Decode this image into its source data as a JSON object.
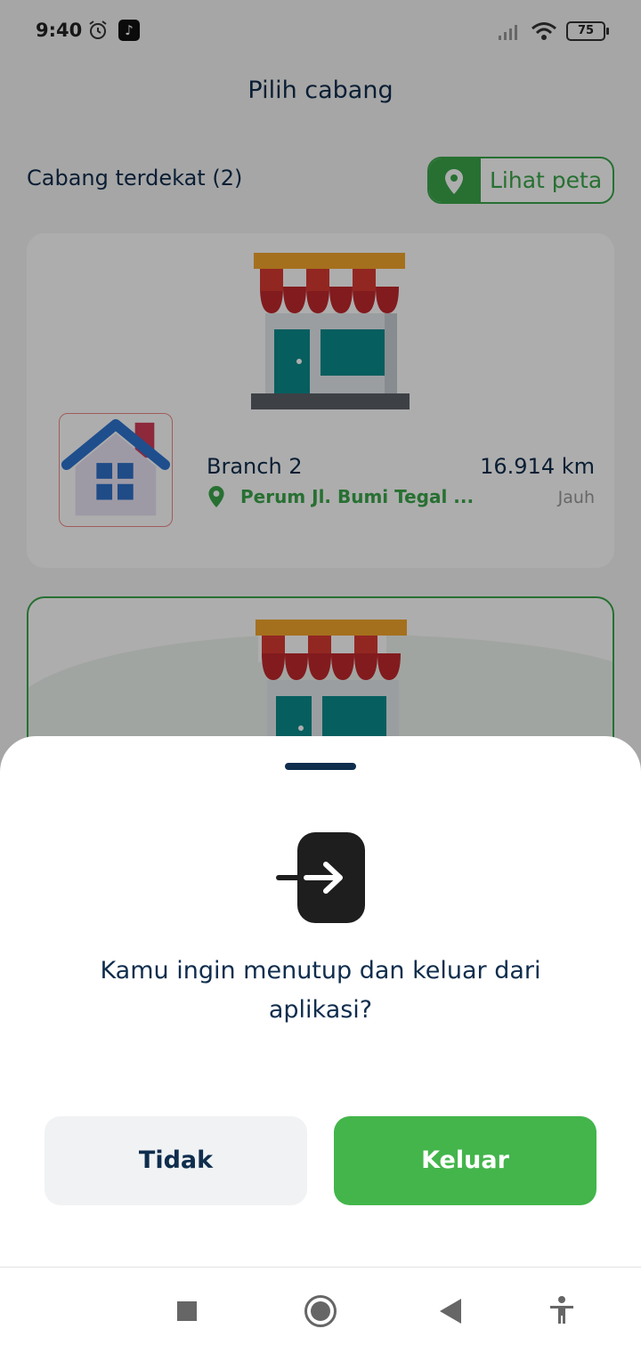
{
  "status_bar": {
    "time": "9:40",
    "battery": "75",
    "icons": [
      "alarm-icon",
      "tiktok-icon",
      "signal-icon",
      "wifi-icon",
      "battery-icon"
    ]
  },
  "header": {
    "title": "Pilih cabang"
  },
  "branches": {
    "nearby_label": "Cabang terdekat (2)",
    "map_button_label": "Lihat peta",
    "items": [
      {
        "name": "Branch 2",
        "address": "Perum Jl. Bumi Tegal ...",
        "distance": "16.914 km",
        "proximity": "Jauh"
      }
    ]
  },
  "exit_dialog": {
    "icon": "exit-icon",
    "message": "Kamu ingin menutup dan keluar dari aplikasi?",
    "cancel_label": "Tidak",
    "confirm_label": "Keluar",
    "colors": {
      "confirm": "#43b54b",
      "cancel": "#f0f2f4",
      "text": "#0f2d4d"
    }
  },
  "navigation": {
    "icons": [
      "recents-icon",
      "home-icon",
      "back-icon",
      "accessibility-icon"
    ]
  },
  "colors": {
    "accent": "#3aa64a",
    "title_text": "#0f2d4d"
  }
}
